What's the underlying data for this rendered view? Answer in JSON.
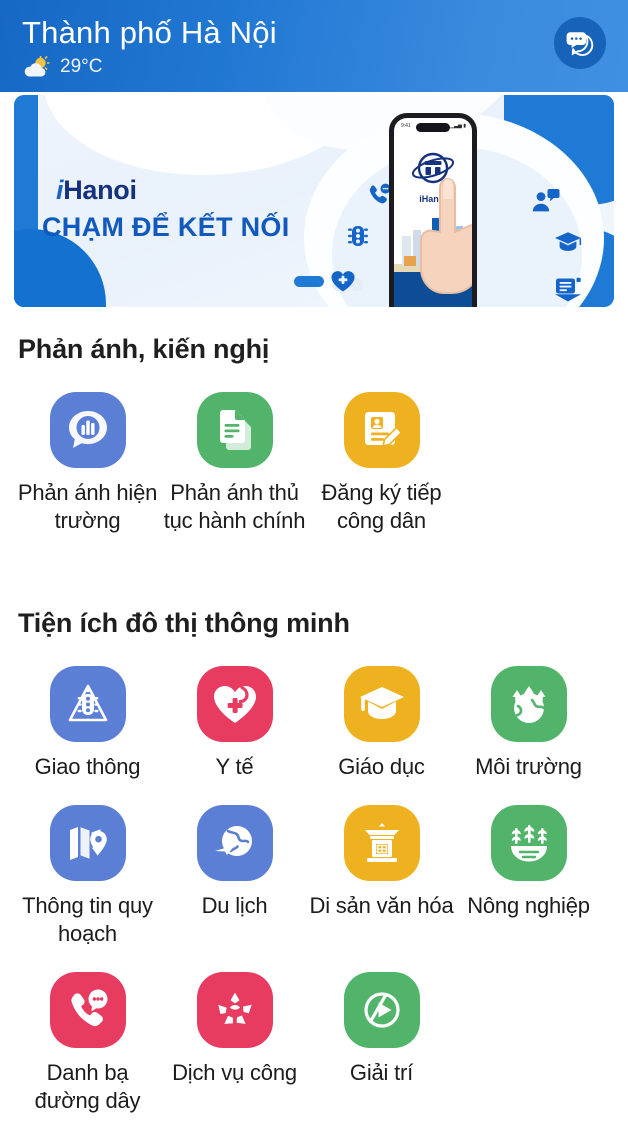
{
  "header": {
    "title": "Thành phố Hà Nội",
    "weather_icon": "sun-behind-cloud-icon",
    "temperature": "29°C",
    "chat_button_icon": "chat-bubbles-icon",
    "bg_color": "#1f7ad6",
    "chat_button_color": "#1763ba"
  },
  "banner": {
    "logo_i": "i",
    "logo_text": "Hanoi",
    "tagline": "CHẠM ĐỂ KẾT NỐI",
    "phone_app_name": "iHanoi",
    "phone_status_left": "9:41",
    "phone_status_right": "▁▃▅ ▮",
    "logo_color": "#16317e",
    "tagline_color": "#1159bd",
    "accent_color": "#1f7ad6",
    "float_icons": [
      "phone-chat-icon",
      "traffic-light-icon",
      "heart-plus-icon",
      "person-chat-icon",
      "graduation-cap-icon",
      "document-mail-icon"
    ]
  },
  "sections": [
    {
      "title": "Phản ánh, kiến nghị",
      "items": [
        {
          "label": "Phản ánh hiện trường",
          "icon": "megaphone-city-icon",
          "color": "#5b7fd4",
          "swatch": "sq-blue"
        },
        {
          "label": "Phản ánh thủ tục hành chính",
          "icon": "documents-icon",
          "color": "#52b46b",
          "swatch": "sq-green"
        },
        {
          "label": "Đăng ký tiếp công dân",
          "icon": "id-card-pencil-icon",
          "color": "#eeb220",
          "swatch": "sq-yellow"
        }
      ]
    },
    {
      "title": "Tiện ích đô thị thông minh",
      "items": [
        {
          "label": "Giao thông",
          "icon": "traffic-light-icon",
          "color": "#5b7fd4",
          "swatch": "sq-blue"
        },
        {
          "label": "Y tế",
          "icon": "heart-plus-icon",
          "color": "#e73b60",
          "swatch": "sq-pink"
        },
        {
          "label": "Giáo dục",
          "icon": "graduation-cap-icon",
          "color": "#eeb220",
          "swatch": "sq-yellow"
        },
        {
          "label": "Môi trường",
          "icon": "earth-trees-icon",
          "color": "#52b46b",
          "swatch": "sq-green"
        },
        {
          "label": "Thông tin quy hoạch",
          "icon": "map-pin-icon",
          "color": "#5b7fd4",
          "swatch": "sq-blue"
        },
        {
          "label": "Du lịch",
          "icon": "globe-travel-icon",
          "color": "#5b7fd4",
          "swatch": "sq-blue"
        },
        {
          "label": "Di sản văn hóa",
          "icon": "temple-gate-icon",
          "color": "#eeb220",
          "swatch": "sq-yellow"
        },
        {
          "label": "Nông nghiệp",
          "icon": "agriculture-crops-icon",
          "color": "#52b46b",
          "swatch": "sq-green"
        },
        {
          "label": "Danh bạ đường dây",
          "icon": "phone-chat-icon",
          "color": "#e73b60",
          "swatch": "sq-pink"
        },
        {
          "label": "Dịch vụ công",
          "icon": "hands-star-icon",
          "color": "#e73b60",
          "swatch": "sq-pink"
        },
        {
          "label": "Giải trí",
          "icon": "play-circle-icon",
          "color": "#52b46b",
          "swatch": "sq-green"
        }
      ]
    }
  ]
}
